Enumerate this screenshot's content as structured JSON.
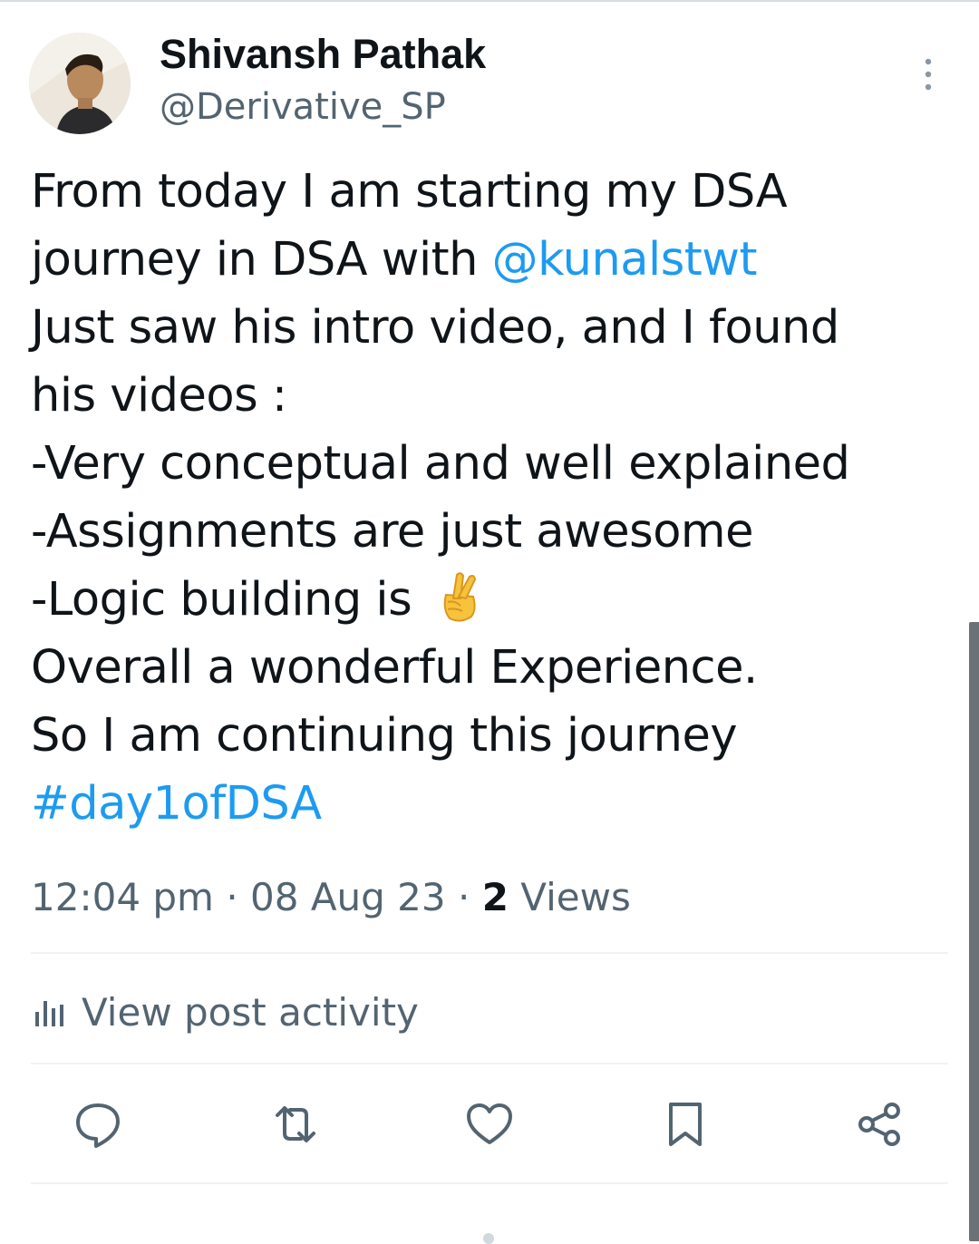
{
  "author": {
    "display_name": "Shivansh Pathak",
    "handle": "@Derivative_SP"
  },
  "post": {
    "lines": [
      {
        "text": "From today I am starting my DSA"
      },
      {
        "text": "journey in DSA with ",
        "mention": "@kunalstwt"
      },
      {
        "text": "Just saw his intro video, and I found"
      },
      {
        "text": "his videos :"
      },
      {
        "text": "-Very conceptual and well explained"
      },
      {
        "text": "-Assignments are just awesome"
      },
      {
        "text": "-Logic building is ",
        "emoji": "crossed-fingers"
      },
      {
        "text": "Overall a wonderful Experience."
      },
      {
        "text": "So I am continuing this journey"
      },
      {
        "hashtag": "#day1ofDSA"
      }
    ]
  },
  "meta": {
    "time": "12:04 pm",
    "sep1": " · ",
    "date": "08 Aug 23",
    "sep2": " · ",
    "views_count": "2",
    "views_label": " Views"
  },
  "activity": {
    "label": "View post activity",
    "icon": "analytics-bars-icon"
  },
  "actions": [
    {
      "name": "reply",
      "icon": "reply-bubble-icon"
    },
    {
      "name": "repost",
      "icon": "repost-arrows-icon"
    },
    {
      "name": "like",
      "icon": "heart-icon"
    },
    {
      "name": "bookmark",
      "icon": "bookmark-icon"
    },
    {
      "name": "share",
      "icon": "share-nodes-icon"
    }
  ],
  "colors": {
    "link": "#1d9bf0",
    "text": "#0f1419",
    "secondary": "#536471",
    "divider": "#eff3f4"
  }
}
